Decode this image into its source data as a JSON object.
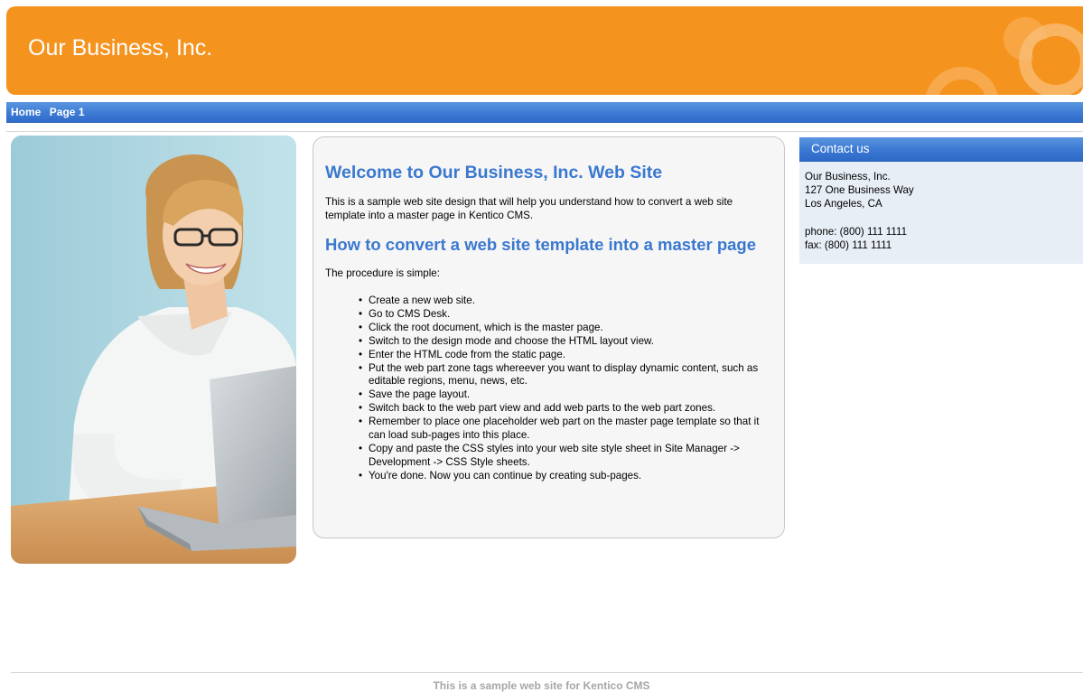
{
  "header": {
    "title": "Our Business, Inc."
  },
  "nav": {
    "items": [
      "Home",
      "Page 1"
    ]
  },
  "main": {
    "heading": "Welcome to Our Business, Inc. Web Site",
    "intro": "This is a sample web site design that will help you understand how to convert a web site template into a master page in Kentico CMS.",
    "subheading": "How to convert a web site template into a master page",
    "procedure_intro": "The procedure is simple:",
    "steps": [
      "Create a new web site.",
      "Go to CMS Desk.",
      "Click the root document, which is the master page.",
      "Switch to the design mode and choose the HTML layout view.",
      "Enter the HTML code from the static page.",
      "Put the web part zone tags whereever you want to display dynamic content, such as editable regions, menu, news, etc.",
      "Save the page layout.",
      "Switch back to the web part view and add web parts to the web part zones.",
      "Remember to place one placeholder web part on the master page template so that it can load sub-pages into this place.",
      "Copy and paste the CSS styles into your web site style sheet in Site Manager -> Development -> CSS Style sheets.",
      "You're done. Now you can continue by creating sub-pages."
    ]
  },
  "contact": {
    "title": "Contact us",
    "company": "Our Business, Inc.",
    "address": "127 One Business Way",
    "city": "Los Angeles, CA",
    "phone": "phone: (800) 111 1111",
    "fax": "fax: (800) 111 1111"
  },
  "footer": {
    "text": "This is a sample web site for Kentico CMS"
  },
  "colors": {
    "header_orange": "#f5931f",
    "nav_blue": "#3f7dd6",
    "heading_blue": "#3a78cf"
  },
  "icons": {
    "photo": "woman-with-laptop-photo"
  }
}
